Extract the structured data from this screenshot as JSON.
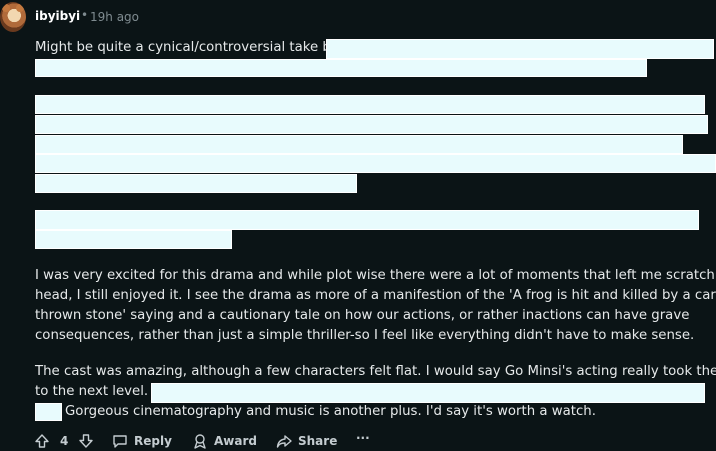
{
  "comment": {
    "username": "ibyibyi",
    "separator": "•",
    "time": "19h ago",
    "paragraphs": {
      "p1_line1": "Might be quite a cynical/controversial take but",
      "p3_line1": "I was very excited for this drama and while plot wise there were a lot of moments that left me scratching my",
      "p3_line2": "head, I still enjoyed it. I see the drama as more of a manifestion of the 'A frog is hit and killed by a carelessly",
      "p3_line3": "thrown stone' saying and a cautionary tale on how our actions, or rather inactions can have grave",
      "p3_line4": "consequences, rather than just a simple thriller-so I feel like everything didn't have to make sense.",
      "p4_line1": "The cast was amazing, although a few characters felt flat. I would say Go Minsi's acting really took the drama",
      "p4_line2": "to the next level. T",
      "p4_line3": "Gorgeous cinematography and music is another plus. I'd say it's worth a watch."
    }
  },
  "actions": {
    "vote_count": "4",
    "reply_label": "Reply",
    "award_label": "Award",
    "share_label": "Share",
    "more_label": "···"
  }
}
